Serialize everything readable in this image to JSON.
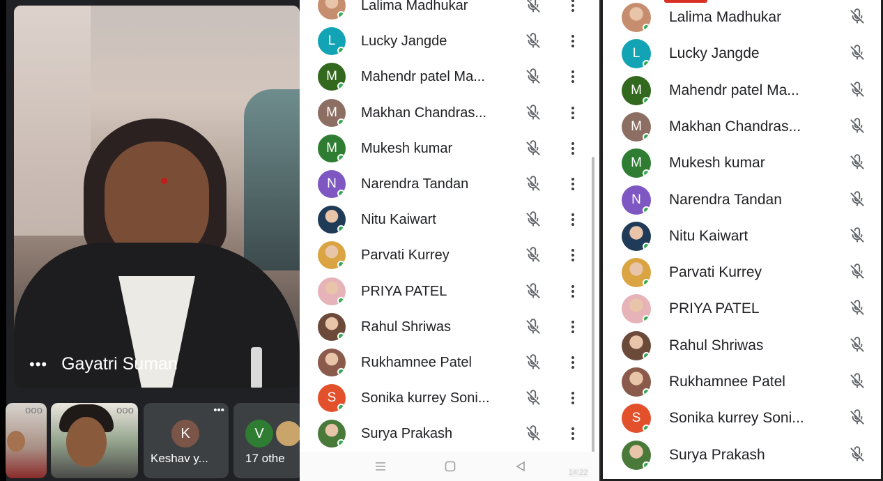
{
  "video": {
    "main_speaker": "Gayatri Suman",
    "more_glyph": "•••",
    "thumbnails": [
      {
        "more_glyph": "ooo"
      },
      {
        "more_glyph": "ooo"
      },
      {
        "initial": "K",
        "label": "Keshav y...",
        "more_glyph": "•••",
        "avatar_color": "#7a5548"
      },
      {
        "initial": "V",
        "label": "17 othe",
        "avatar_color": "#2e7d32"
      }
    ]
  },
  "participants_left": [
    {
      "name": "Lalima Madhukar",
      "avatar": "photo",
      "tone": "#c68e6f"
    },
    {
      "name": "Lucky Jangde",
      "avatar": "initial",
      "initial": "L",
      "color": "#12a4b4"
    },
    {
      "name": "Mahendr patel Ma...",
      "avatar": "initial",
      "initial": "M",
      "color": "#33691e"
    },
    {
      "name": "Makhan Chandras...",
      "avatar": "initial",
      "initial": "M",
      "color": "#8d6e63"
    },
    {
      "name": "Mukesh kumar",
      "avatar": "initial",
      "initial": "M",
      "color": "#2e7d32"
    },
    {
      "name": "Narendra Tandan",
      "avatar": "initial",
      "initial": "N",
      "color": "#7e57c2"
    },
    {
      "name": "Nitu Kaiwart",
      "avatar": "photo",
      "tone": "#1f3b57"
    },
    {
      "name": "Parvati Kurrey",
      "avatar": "photo",
      "tone": "#d9a441"
    },
    {
      "name": "PRIYA PATEL",
      "avatar": "photo",
      "tone": "#e6b3b8"
    },
    {
      "name": "Rahul Shriwas",
      "avatar": "photo",
      "tone": "#6b4a3a"
    },
    {
      "name": "Rukhamnee Patel",
      "avatar": "photo",
      "tone": "#8a5a4a"
    },
    {
      "name": "Sonika kurrey Soni...",
      "avatar": "initial",
      "initial": "S",
      "color": "#e2502c"
    },
    {
      "name": "Surya Prakash",
      "avatar": "photo",
      "tone": "#4a7a3a"
    }
  ],
  "participants_right": [
    {
      "name": "Lalima Madhukar",
      "avatar": "photo",
      "tone": "#c68e6f"
    },
    {
      "name": "Lucky Jangde",
      "avatar": "initial",
      "initial": "L",
      "color": "#12a4b4"
    },
    {
      "name": "Mahendr patel Ma...",
      "avatar": "initial",
      "initial": "M",
      "color": "#33691e"
    },
    {
      "name": "Makhan Chandras...",
      "avatar": "initial",
      "initial": "M",
      "color": "#8d6e63"
    },
    {
      "name": "Mukesh kumar",
      "avatar": "initial",
      "initial": "M",
      "color": "#2e7d32"
    },
    {
      "name": "Narendra Tandan",
      "avatar": "initial",
      "initial": "N",
      "color": "#7e57c2"
    },
    {
      "name": "Nitu Kaiwart",
      "avatar": "photo",
      "tone": "#1f3b57"
    },
    {
      "name": "Parvati Kurrey",
      "avatar": "photo",
      "tone": "#d9a441"
    },
    {
      "name": "PRIYA PATEL",
      "avatar": "photo",
      "tone": "#e6b3b8"
    },
    {
      "name": "Rahul Shriwas",
      "avatar": "photo",
      "tone": "#6b4a3a"
    },
    {
      "name": "Rukhamnee Patel",
      "avatar": "photo",
      "tone": "#8a5a4a"
    },
    {
      "name": "Sonika kurrey Soni...",
      "avatar": "initial",
      "initial": "S",
      "color": "#e2502c"
    },
    {
      "name": "Surya Prakash",
      "avatar": "photo",
      "tone": "#4a7a3a"
    }
  ],
  "status_bar": {
    "time": "14:22",
    "nav_icons": [
      "menu-icon",
      "home-icon",
      "back-icon"
    ]
  },
  "colors": {
    "online_dot": "#34a853",
    "mic_off_icon": "#5f6368",
    "text": "#202124"
  }
}
